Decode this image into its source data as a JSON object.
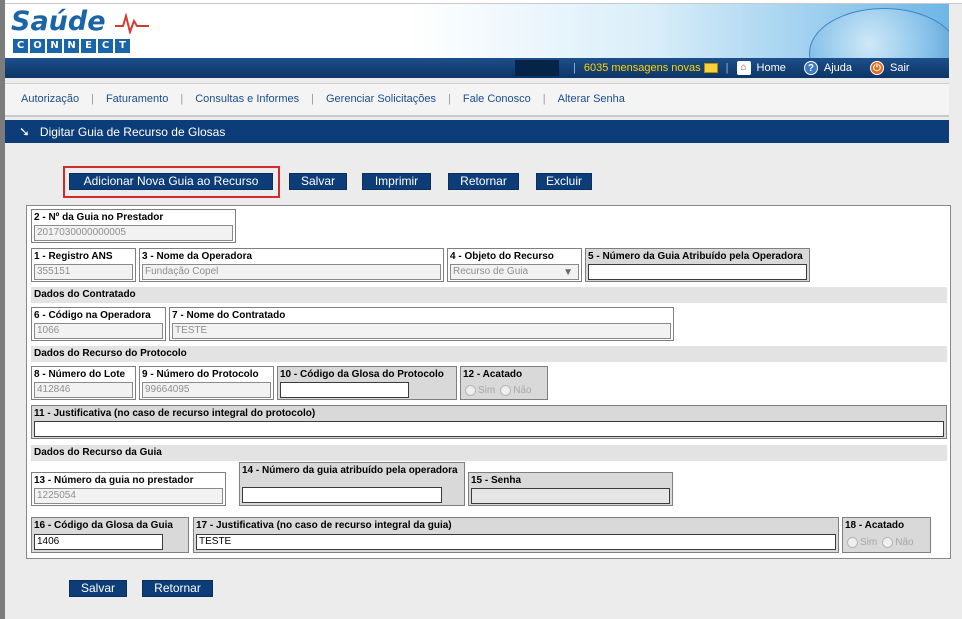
{
  "logo": {
    "name": "Saúde",
    "sub_letters": [
      "C",
      "O",
      "N",
      "N",
      "E",
      "C",
      "T"
    ]
  },
  "topbar": {
    "messages": "6035 mensagens novas",
    "home": "Home",
    "help": "Ajuda",
    "exit": "Sair"
  },
  "menu": {
    "items": [
      "Autorização",
      "Faturamento",
      "Consultas e Informes",
      "Gerenciar Solicitações",
      "Fale Conosco",
      "Alterar Senha"
    ]
  },
  "page": {
    "title": "Digitar Guia de Recurso de Glosas"
  },
  "actions": {
    "add": "Adicionar Nova Guia ao Recurso",
    "save": "Salvar",
    "print": "Imprimir",
    "back": "Retornar",
    "delete": "Excluir"
  },
  "form": {
    "f2": {
      "label": "2 - Nº da Guia no Prestador",
      "value": "2017030000000005"
    },
    "f1": {
      "label": "1 - Registro ANS",
      "value": "355151"
    },
    "f3": {
      "label": "3 - Nome da Operadora",
      "value": "Fundação Copel"
    },
    "f4": {
      "label": "4 - Objeto do Recurso",
      "value": "Recurso de Guia"
    },
    "f5": {
      "label": "5 - Número da Guia Atribuído pela Operadora",
      "value": ""
    },
    "section_contratado": "Dados do Contratado",
    "f6": {
      "label": "6 - Código na Operadora",
      "value": "1066"
    },
    "f7": {
      "label": "7 - Nome do Contratado",
      "value": "TESTE"
    },
    "section_protocolo": "Dados do Recurso do Protocolo",
    "f8": {
      "label": "8 - Número do Lote",
      "value": "412846"
    },
    "f9": {
      "label": "9 - Número do Protocolo",
      "value": "99664095"
    },
    "f10": {
      "label": "10 - Código da Glosa do Protocolo",
      "value": ""
    },
    "f12": {
      "label": "12 - Acatado",
      "yes": "Sim",
      "no": "Não"
    },
    "f11": {
      "label": "11 - Justificativa (no caso de recurso integral do protocolo)",
      "value": ""
    },
    "section_guia": "Dados do Recurso da Guia",
    "f13": {
      "label": "13 - Número da guia no prestador",
      "value": "1225054"
    },
    "f14": {
      "label": "14 - Número da guia atribuído pela operadora",
      "value": ""
    },
    "f15": {
      "label": "15 - Senha",
      "value": ""
    },
    "f16": {
      "label": "16 - Código da Glosa da Guia",
      "value": "1406"
    },
    "f17": {
      "label": "17 - Justificativa (no caso de recurso integral da guia)",
      "value": "TESTE"
    },
    "f18": {
      "label": "18 - Acatado",
      "yes": "Sim",
      "no": "Não"
    }
  }
}
